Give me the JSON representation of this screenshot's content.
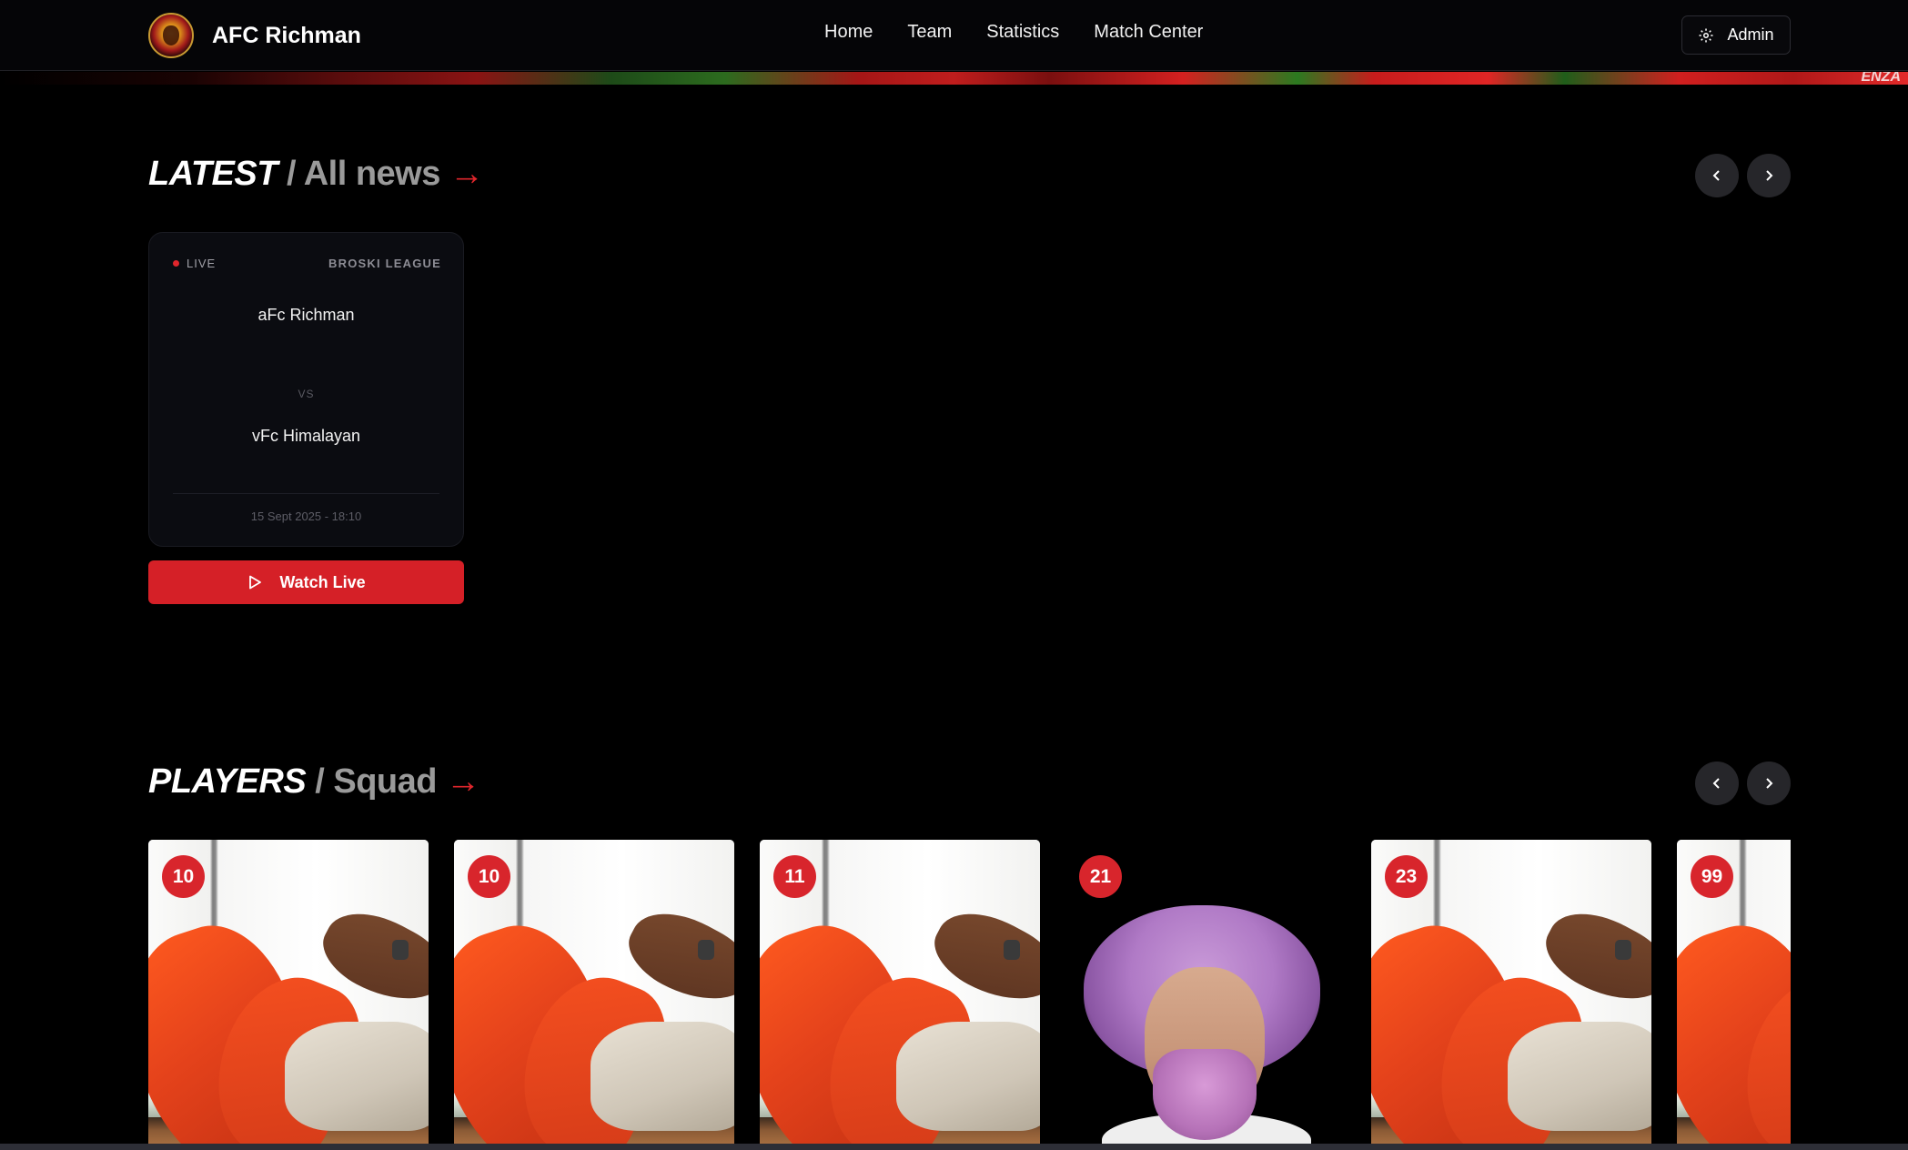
{
  "brand": {
    "name": "AFC Richman"
  },
  "nav": {
    "items": [
      "Home",
      "Team",
      "Statistics",
      "Match Center"
    ],
    "admin_label": "Admin"
  },
  "banner": {
    "text": "ENZA"
  },
  "latest": {
    "title_main": "LATEST",
    "title_sub": "/ All news",
    "arrow": "→"
  },
  "match": {
    "status": "LIVE",
    "league": "BROSKI LEAGUE",
    "home_team": "aFc Richman",
    "vs": "VS",
    "away_team": "vFc Himalayan",
    "datetime": "15 Sept 2025 - 18:10",
    "watch_label": "Watch Live"
  },
  "players": {
    "title_main": "PLAYERS",
    "title_sub": "/ Squad",
    "arrow": "→",
    "cards": [
      {
        "number": "10",
        "photo": "abs-workout"
      },
      {
        "number": "10",
        "photo": "abs-workout"
      },
      {
        "number": "11",
        "photo": "abs-workout"
      },
      {
        "number": "21",
        "photo": "purple-afro-portrait"
      },
      {
        "number": "23",
        "photo": "abs-workout"
      },
      {
        "number": "99",
        "photo": "abs-workout"
      }
    ]
  },
  "colors": {
    "accent": "#d8252c",
    "background": "#000000",
    "card": "#0b0c11"
  }
}
